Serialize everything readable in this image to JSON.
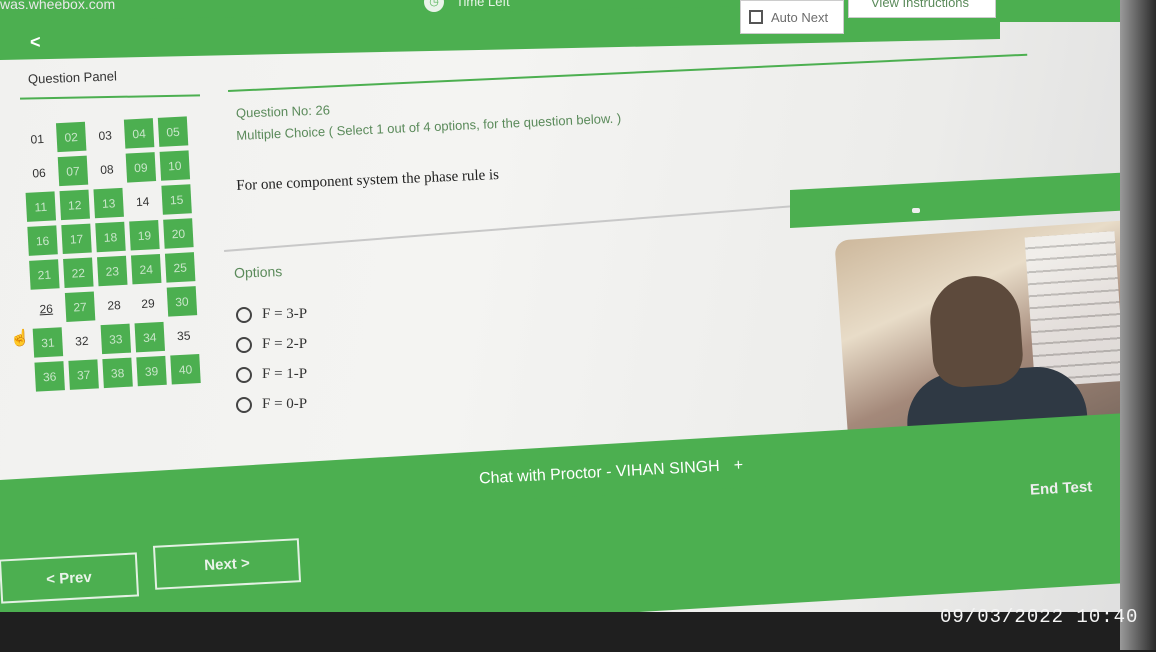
{
  "browser": {
    "url": "was.wheebox.com",
    "timer_label": "Time Left"
  },
  "header": {
    "auto_next": "Auto Next",
    "view_instructions": "View Instructions"
  },
  "panel": {
    "title": "Question Panel",
    "cells": [
      {
        "n": "01",
        "s": "una"
      },
      {
        "n": "02",
        "s": "ans"
      },
      {
        "n": "03",
        "s": "una"
      },
      {
        "n": "04",
        "s": "ans"
      },
      {
        "n": "05",
        "s": "ans"
      },
      {
        "n": "06",
        "s": "una"
      },
      {
        "n": "07",
        "s": "ans"
      },
      {
        "n": "08",
        "s": "una"
      },
      {
        "n": "09",
        "s": "ans"
      },
      {
        "n": "10",
        "s": "ans"
      },
      {
        "n": "11",
        "s": "ans"
      },
      {
        "n": "12",
        "s": "ans"
      },
      {
        "n": "13",
        "s": "ans"
      },
      {
        "n": "14",
        "s": "una"
      },
      {
        "n": "15",
        "s": "ans"
      },
      {
        "n": "16",
        "s": "ans"
      },
      {
        "n": "17",
        "s": "ans"
      },
      {
        "n": "18",
        "s": "ans"
      },
      {
        "n": "19",
        "s": "ans"
      },
      {
        "n": "20",
        "s": "ans"
      },
      {
        "n": "21",
        "s": "ans"
      },
      {
        "n": "22",
        "s": "ans"
      },
      {
        "n": "23",
        "s": "ans"
      },
      {
        "n": "24",
        "s": "ans"
      },
      {
        "n": "25",
        "s": "ans"
      },
      {
        "n": "26",
        "s": "cur"
      },
      {
        "n": "27",
        "s": "ans"
      },
      {
        "n": "28",
        "s": "una"
      },
      {
        "n": "29",
        "s": "una"
      },
      {
        "n": "30",
        "s": "ans"
      },
      {
        "n": "31",
        "s": "ans"
      },
      {
        "n": "32",
        "s": "una"
      },
      {
        "n": "33",
        "s": "ans"
      },
      {
        "n": "34",
        "s": "ans"
      },
      {
        "n": "35",
        "s": "una"
      },
      {
        "n": "36",
        "s": "ans"
      },
      {
        "n": "37",
        "s": "ans"
      },
      {
        "n": "38",
        "s": "ans"
      },
      {
        "n": "39",
        "s": "ans"
      },
      {
        "n": "40",
        "s": "ans"
      }
    ]
  },
  "question": {
    "number_label": "Question No: 26",
    "type": "Multiple Choice ( Select 1 out of 4 options, for the question below. )",
    "text": "For one component system the phase rule is",
    "options_label": "Options",
    "options": [
      "F = 3-P",
      "F = 2-P",
      "F = 1-P",
      "F = 0-P"
    ]
  },
  "footer": {
    "chat": "Chat with Proctor - VIHAN SINGH",
    "chat_plus": "+",
    "end_test": "End Test",
    "prev": "< Prev",
    "next": "Next >"
  },
  "photo_timestamp": "09/03/2022 10:40",
  "colors": {
    "accent": "#4caf50",
    "answered_text": "#c8e6c9"
  }
}
